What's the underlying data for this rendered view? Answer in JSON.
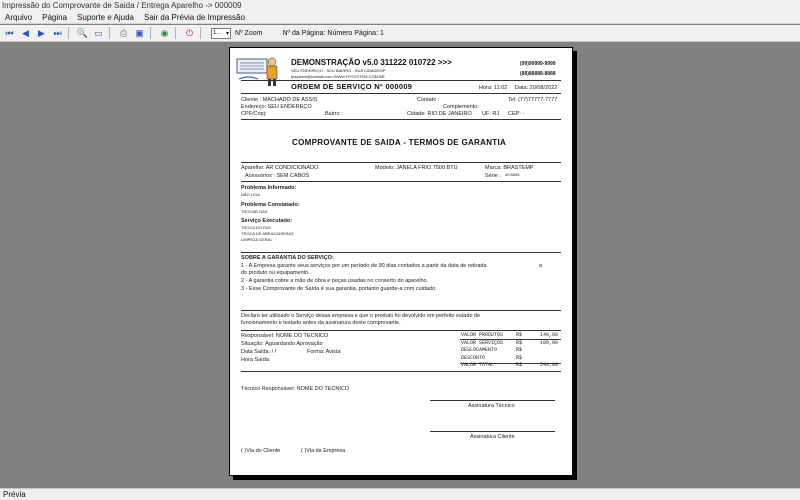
{
  "window": {
    "title": "Impressão do Comprovante de Saida / Entrega Aparelho -> 000009"
  },
  "menu": [
    "Arquivo",
    "Página",
    "Suporte e Ajuda",
    "Sair da Prévia de Impressão"
  ],
  "toolbar": {
    "zoom_value": "1...",
    "zoom_label": "Nº Zoom",
    "page_label": "Nº da Página: Número Página: 1"
  },
  "status": {
    "text": "Prévia"
  },
  "doc": {
    "company_name": "DEMONSTRAÇÃO v5.0 311222 010722 >>>",
    "company_addr": "SEU ENDEREÇO - SEU BAIRRO - SUA CIDADE/SP",
    "company_web": "fpsystem@hotmail.com  WWW.FPSYSTEM.COM.BR",
    "phone1": "(99)99999-9999",
    "phone2": "(88)88888-8888",
    "os_title": "ORDEM DE SERVIÇO Nº 000009",
    "hora": "Hora: 11:02",
    "data": "Data: 20/08/2022",
    "cliente": "Cliente  :  MACHADO DE ASSIS",
    "contato": "Contato :",
    "tel": "Tel: (77)77777-7777",
    "endereco": "Endereço: SEU ENDEREÇO",
    "complemento": "Complemento:",
    "cpf": "CPF/Cnpj:",
    "bairro": "Bairro :",
    "cidade": "Cidade: RIO DE JANEIRO",
    "uf": "UF: RJ",
    "cep": "CEP:    -",
    "title2": "COMPROVANTE DE SAIDA - TERMOS DE GARANTIA",
    "aparelho": "Aparelho: AR CONDICIONADO",
    "modelo": "Modelo: JANELA FRIO 7500 BTU",
    "marca": "Marca: BRASTEMP",
    "acessorios": "Acessórios  :  SEM CABOS",
    "serie": "Série :",
    "serie_val": "40.8846",
    "prob_inf_label": "Problema Informado:",
    "prob_inf": "NÃO LIGA",
    "prob_const_label": "Problema Constatado:",
    "prob_const": "TROCAR GAS",
    "serv_label": "Serviço Executado:",
    "serv1": "TROCA DO FAS",
    "serv2": "TROCA DE ABRACADEIRAS",
    "serv3": "LIMPEZA GERAL",
    "gar_label": "SOBRE A GARANTIA DO SERVIÇO:",
    "gar1": "1 - A Empresa garante seus serviços por um período de 90 dias contados a partir da data de retirada",
    "gar1b": "a",
    "gar1c": "do produto ou equipamento.",
    "gar2": "2 - A garantia cobre a mão de obra e peças usadas no conserto do aparelho.",
    "gar3": "3 - Esse Comprovante de Saída é sua garantia, portanto guarde-a com cuidado.",
    "decl1": "Declaro ter utilizado o Serviço dessa empresa e que o produto foi devolvido em perfeito estado de",
    "decl2": "funcionamento e testado antes da assinatura deste comprovante.",
    "responsavel": "Responsável: NOME DO TECNICO",
    "situacao": "Situação:  Aguardando Aprovação",
    "data_saida": "Data Saída:   /  /",
    "forma": "Forma: Avista",
    "hora_saida": "Hora Saída:",
    "totals": [
      {
        "label": "VALOR PRODUTOS",
        "cur": "R$",
        "value": "140,00"
      },
      {
        "label": "VALOR SERVIÇOS",
        "cur": "R$",
        "value": "100,00"
      },
      {
        "label": "DESLOCAMENTO",
        "cur": "R$",
        "value": ""
      },
      {
        "label": "DESCONTO",
        "cur": "R$",
        "value": ""
      },
      {
        "label": "VALOR TOTAL",
        "cur": "R$",
        "value": "240,00"
      }
    ],
    "tecnico": "Técnico Responsável: NOME DO TECNICO",
    "ass_tecnico": "Assinatura Técnico",
    "ass_cliente": "Assinatura Cliente",
    "via_cliente": "(  )Via do Cliente",
    "via_empresa": "(  )Via da Empresa"
  }
}
